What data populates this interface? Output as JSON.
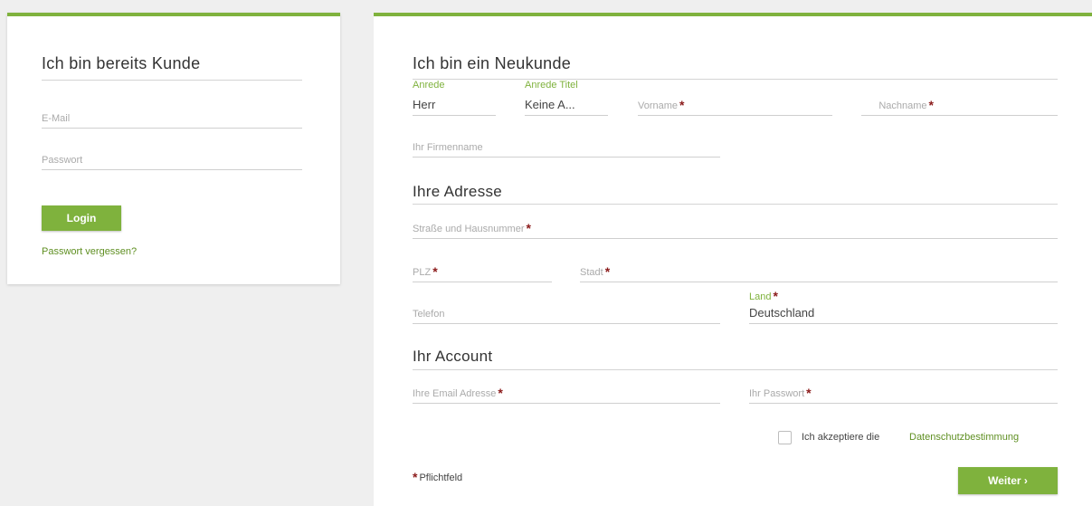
{
  "login": {
    "title": "Ich bin bereits Kunde",
    "email_placeholder": "E-Mail",
    "password_placeholder": "Passwort",
    "login_button": "Login",
    "forgot_password": "Passwort vergessen?"
  },
  "register": {
    "title": "Ich bin ein Neukunde",
    "anrede_label": "Anrede",
    "anrede_value": "Herr",
    "anrede_titel_label": "Anrede Titel",
    "anrede_titel_value": "Keine A...",
    "vorname_placeholder": "Vorname",
    "nachname_placeholder": "Nachname",
    "firma_placeholder": "Ihr Firmenname",
    "address_title": "Ihre Adresse",
    "street_placeholder": "Straße und Hausnummer",
    "plz_placeholder": "PLZ",
    "stadt_placeholder": "Stadt",
    "telefon_placeholder": "Telefon",
    "land_label": "Land",
    "land_value": "Deutschland",
    "account_title": "Ihr Account",
    "email_placeholder": "Ihre Email Adresse",
    "password_placeholder": "Ihr Passwort",
    "privacy_text": "Ich akzeptiere die",
    "privacy_link": "Datenschutzbestimmung",
    "required_note": "Pflichtfeld",
    "required_marker": "*",
    "continue_button": "Weiter ›"
  },
  "colors": {
    "accent": "#7fb23d",
    "required": "#8b1a1a",
    "background": "#efefef"
  }
}
